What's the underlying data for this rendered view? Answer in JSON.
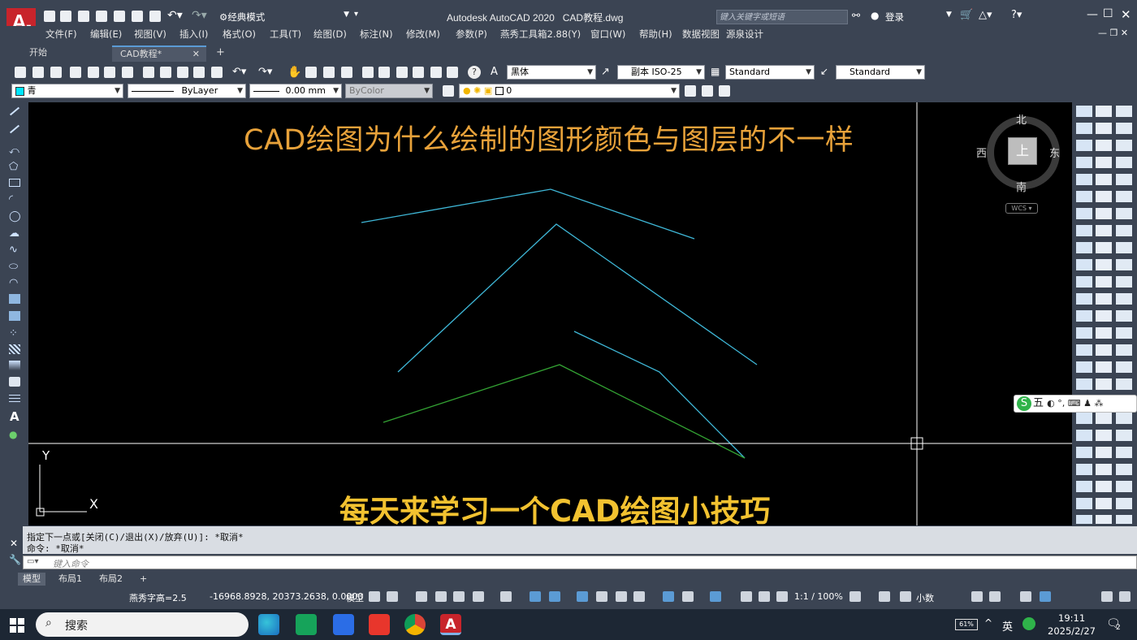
{
  "window": {
    "title": "Autodesk AutoCAD 2020   CAD教程.dwg",
    "workspace": "经典模式",
    "search_placeholder": "键入关键字或短语",
    "login": "登录"
  },
  "menu": [
    "文件(F)",
    "编辑(E)",
    "视图(V)",
    "插入(I)",
    "格式(O)",
    "工具(T)",
    "绘图(D)",
    "标注(N)",
    "修改(M)",
    "参数(P)",
    "燕秀工具箱2.88(Y)",
    "窗口(W)",
    "帮助(H)",
    "数据视图",
    "源泉设计"
  ],
  "doc_tabs": {
    "start": "开始",
    "current": "CAD教程*",
    "add": "+"
  },
  "toolbar1": {
    "font": "黑体",
    "dimstyle": "副本 ISO-25",
    "tablestyle": "Standard",
    "mleaderstyle": "Standard"
  },
  "toolbar2": {
    "color": "青",
    "linetype": "ByLayer",
    "lineweight": "0.00 mm",
    "plotstyle": "ByColor",
    "layer": "0"
  },
  "canvas": {
    "title_text": "CAD绘图为什么绘制的图形颜色与图层的不一样",
    "subtitle_text": "每天来学习一个CAD绘图小技巧",
    "viewcube": {
      "north": "北",
      "south": "南",
      "east": "东",
      "west": "西",
      "top": "上",
      "wcs": "WCS"
    },
    "ucs": {
      "x": "X",
      "y": "Y"
    },
    "colors": {
      "cyan": "#3fb8d8",
      "green": "#33a233",
      "caption": "#e8a23a",
      "subtitle": "#f2c230"
    }
  },
  "ime": {
    "mode": "五"
  },
  "command": {
    "line1": "指定下一点或[关闭(C)/退出(X)/放弃(U)]: *取消*",
    "line2": "命令: *取消*",
    "input_placeholder": "键入命令"
  },
  "layout_tabs": [
    "模型",
    "布局1",
    "布局2",
    "+"
  ],
  "status": {
    "text_height": "燕秀字高=2.5",
    "coords": "-16968.8928, 20373.2638, 0.0000",
    "space": "模型",
    "scale": "1:1 / 100%",
    "units": "小数"
  },
  "taskbar": {
    "search": "搜索",
    "battery": "61%",
    "ime": "英",
    "time": "19:11",
    "date": "2025/2/27",
    "notifications": "2"
  }
}
